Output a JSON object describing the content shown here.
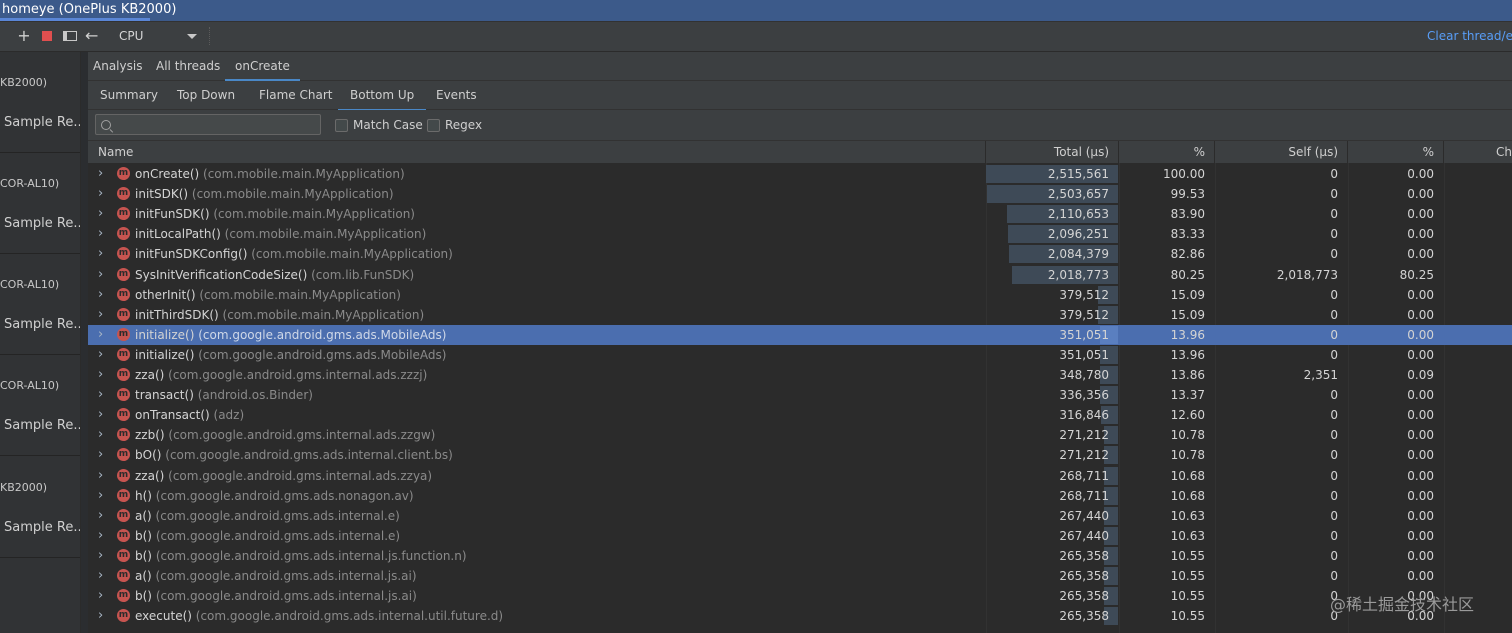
{
  "window": {
    "title": "homeye (OnePlus KB2000)"
  },
  "toolbar": {
    "plus_icon": "+",
    "back_icon": "←",
    "cpu_select": "CPU",
    "clear_link": "Clear thread/ev"
  },
  "sidebar": {
    "sessions": [
      {
        "device": "KB2000)",
        "label": "Sample Re..."
      },
      {
        "device": "COR-AL10)",
        "label": "Sample Re..."
      },
      {
        "device": "COR-AL10)",
        "label": "Sample Re..."
      },
      {
        "device": "COR-AL10)",
        "label": "Sample Re..."
      },
      {
        "device": "KB2000)",
        "label": "Sample Re..."
      }
    ]
  },
  "tabs_top": [
    "Analysis",
    "All threads",
    "onCreate"
  ],
  "tabs_sub": [
    "Summary",
    "Top Down",
    "Flame Chart",
    "Bottom Up",
    "Events"
  ],
  "search": {
    "placeholder": "",
    "match_case": "Match Case",
    "regex": "Regex"
  },
  "columns": [
    "Name",
    "Total (μs)",
    "%",
    "Self (μs)",
    "%",
    "Ch"
  ],
  "colors": {
    "accent": "#4a88c7",
    "selection": "#4b6eaf",
    "method_badge": "#c75450",
    "link": "#589df6"
  },
  "rows": [
    {
      "fn": "onCreate()",
      "pkg": "(com.mobile.main.MyApplication)",
      "total": "2,515,561",
      "pct": "100.00",
      "self": "0",
      "spct": "0.00",
      "frac": 1.0
    },
    {
      "fn": "initSDK()",
      "pkg": "(com.mobile.main.MyApplication)",
      "total": "2,503,657",
      "pct": "99.53",
      "self": "0",
      "spct": "0.00",
      "frac": 0.9953
    },
    {
      "fn": "initFunSDK()",
      "pkg": "(com.mobile.main.MyApplication)",
      "total": "2,110,653",
      "pct": "83.90",
      "self": "0",
      "spct": "0.00",
      "frac": 0.839
    },
    {
      "fn": "initLocalPath()",
      "pkg": "(com.mobile.main.MyApplication)",
      "total": "2,096,251",
      "pct": "83.33",
      "self": "0",
      "spct": "0.00",
      "frac": 0.8333
    },
    {
      "fn": "initFunSDKConfig()",
      "pkg": "(com.mobile.main.MyApplication)",
      "total": "2,084,379",
      "pct": "82.86",
      "self": "0",
      "spct": "0.00",
      "frac": 0.8286
    },
    {
      "fn": "SysInitVerificationCodeSize()",
      "pkg": "(com.lib.FunSDK)",
      "total": "2,018,773",
      "pct": "80.25",
      "self": "2,018,773",
      "spct": "80.25",
      "frac": 0.8025
    },
    {
      "fn": "otherInit()",
      "pkg": "(com.mobile.main.MyApplication)",
      "total": "379,512",
      "pct": "15.09",
      "self": "0",
      "spct": "0.00",
      "frac": 0.1509
    },
    {
      "fn": "initThirdSDK()",
      "pkg": "(com.mobile.main.MyApplication)",
      "total": "379,512",
      "pct": "15.09",
      "self": "0",
      "spct": "0.00",
      "frac": 0.1509
    },
    {
      "fn": "initialize()",
      "pkg": "(com.google.android.gms.ads.MobileAds)",
      "total": "351,051",
      "pct": "13.96",
      "self": "0",
      "spct": "0.00",
      "frac": 0.1396,
      "selected": true
    },
    {
      "fn": "initialize()",
      "pkg": "(com.google.android.gms.ads.MobileAds)",
      "total": "351,051",
      "pct": "13.96",
      "self": "0",
      "spct": "0.00",
      "frac": 0.1396
    },
    {
      "fn": "zza()",
      "pkg": "(com.google.android.gms.internal.ads.zzzj)",
      "total": "348,780",
      "pct": "13.86",
      "self": "2,351",
      "spct": "0.09",
      "frac": 0.1386
    },
    {
      "fn": "transact()",
      "pkg": "(android.os.Binder)",
      "total": "336,356",
      "pct": "13.37",
      "self": "0",
      "spct": "0.00",
      "frac": 0.1337
    },
    {
      "fn": "onTransact()",
      "pkg": "(adz)",
      "total": "316,846",
      "pct": "12.60",
      "self": "0",
      "spct": "0.00",
      "frac": 0.126
    },
    {
      "fn": "zzb()",
      "pkg": "(com.google.android.gms.internal.ads.zzgw)",
      "total": "271,212",
      "pct": "10.78",
      "self": "0",
      "spct": "0.00",
      "frac": 0.1078
    },
    {
      "fn": "bO()",
      "pkg": "(com.google.android.gms.ads.internal.client.bs)",
      "total": "271,212",
      "pct": "10.78",
      "self": "0",
      "spct": "0.00",
      "frac": 0.1078
    },
    {
      "fn": "zza()",
      "pkg": "(com.google.android.gms.internal.ads.zzya)",
      "total": "268,711",
      "pct": "10.68",
      "self": "0",
      "spct": "0.00",
      "frac": 0.1068
    },
    {
      "fn": "h()",
      "pkg": "(com.google.android.gms.ads.nonagon.av)",
      "total": "268,711",
      "pct": "10.68",
      "self": "0",
      "spct": "0.00",
      "frac": 0.1068
    },
    {
      "fn": "a()",
      "pkg": "(com.google.android.gms.ads.internal.e)",
      "total": "267,440",
      "pct": "10.63",
      "self": "0",
      "spct": "0.00",
      "frac": 0.1063
    },
    {
      "fn": "b()",
      "pkg": "(com.google.android.gms.ads.internal.e)",
      "total": "267,440",
      "pct": "10.63",
      "self": "0",
      "spct": "0.00",
      "frac": 0.1063
    },
    {
      "fn": "b()",
      "pkg": "(com.google.android.gms.ads.internal.js.function.n)",
      "total": "265,358",
      "pct": "10.55",
      "self": "0",
      "spct": "0.00",
      "frac": 0.1055
    },
    {
      "fn": "a()",
      "pkg": "(com.google.android.gms.ads.internal.js.ai)",
      "total": "265,358",
      "pct": "10.55",
      "self": "0",
      "spct": "0.00",
      "frac": 0.1055
    },
    {
      "fn": "b()",
      "pkg": "(com.google.android.gms.ads.internal.js.ai)",
      "total": "265,358",
      "pct": "10.55",
      "self": "0",
      "spct": "0.00",
      "frac": 0.1055
    },
    {
      "fn": "execute()",
      "pkg": "(com.google.android.gms.ads.internal.util.future.d)",
      "total": "265,358",
      "pct": "10.55",
      "self": "0",
      "spct": "0.00",
      "frac": 0.1055
    }
  ],
  "method_badge_glyph": "m",
  "chevron_glyph": "›",
  "watermark": "@稀土掘金技术社区"
}
